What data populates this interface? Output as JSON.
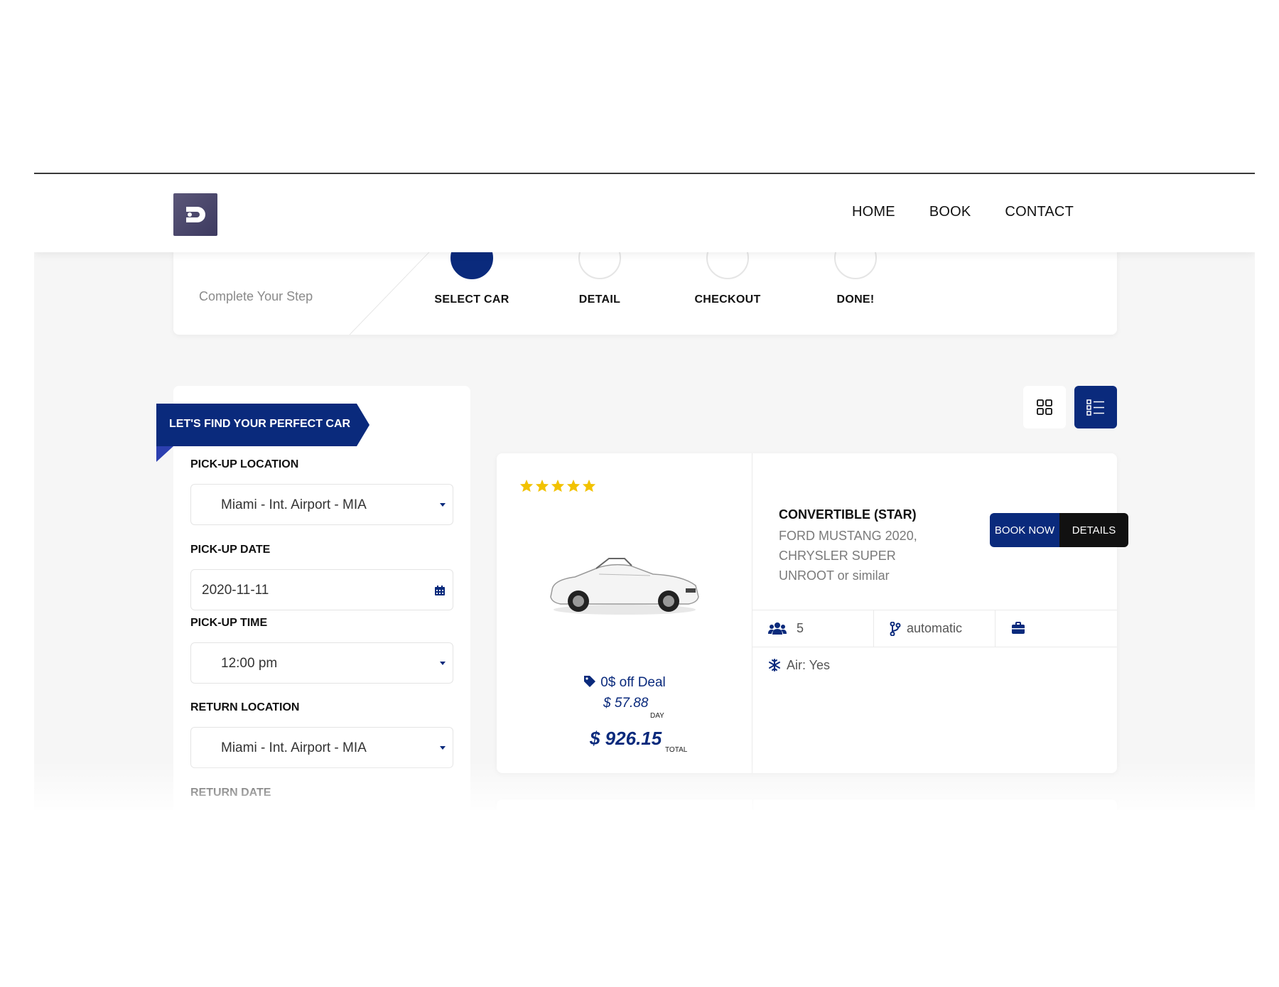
{
  "header": {
    "nav": [
      "HOME",
      "BOOK",
      "CONTACT"
    ]
  },
  "steps": {
    "subtitle": "Complete Your Step",
    "items": [
      "SELECT CAR",
      "DETAIL",
      "CHECKOUT",
      "DONE!"
    ],
    "active_index": 0
  },
  "sidebar": {
    "ribbon": "LET'S FIND YOUR PERFECT CAR",
    "pickup_location_label": "PICK-UP LOCATION",
    "pickup_location_value": "Miami - Int. Airport - MIA",
    "pickup_date_label": "PICK-UP DATE",
    "pickup_date_value": "2020-11-11",
    "pickup_time_label": "PICK-UP TIME",
    "pickup_time_value": "12:00 pm",
    "return_location_label": "RETURN LOCATION",
    "return_location_value": "Miami - Int. Airport - MIA",
    "return_date_label": "RETURN DATE"
  },
  "view_toggle": {
    "selected": "list"
  },
  "car": {
    "rating": 5,
    "title": "CONVERTIBLE (STAR)",
    "subtitle": "FORD MUSTANG 2020, CHRYSLER SUPER UNROOT or similar",
    "book_label": "BOOK NOW",
    "details_label": "DETAILS",
    "deal": "0$ off Deal",
    "price_day": "$ 57.88",
    "price_day_unit": "DAY",
    "price_total": "$ 926.15",
    "price_total_unit": "TOTAL",
    "seats": "5",
    "transmission": "automatic",
    "air": "Air: Yes"
  },
  "colors": {
    "primary": "#0a2a7c",
    "dark": "#111111",
    "star": "#f2c200"
  }
}
